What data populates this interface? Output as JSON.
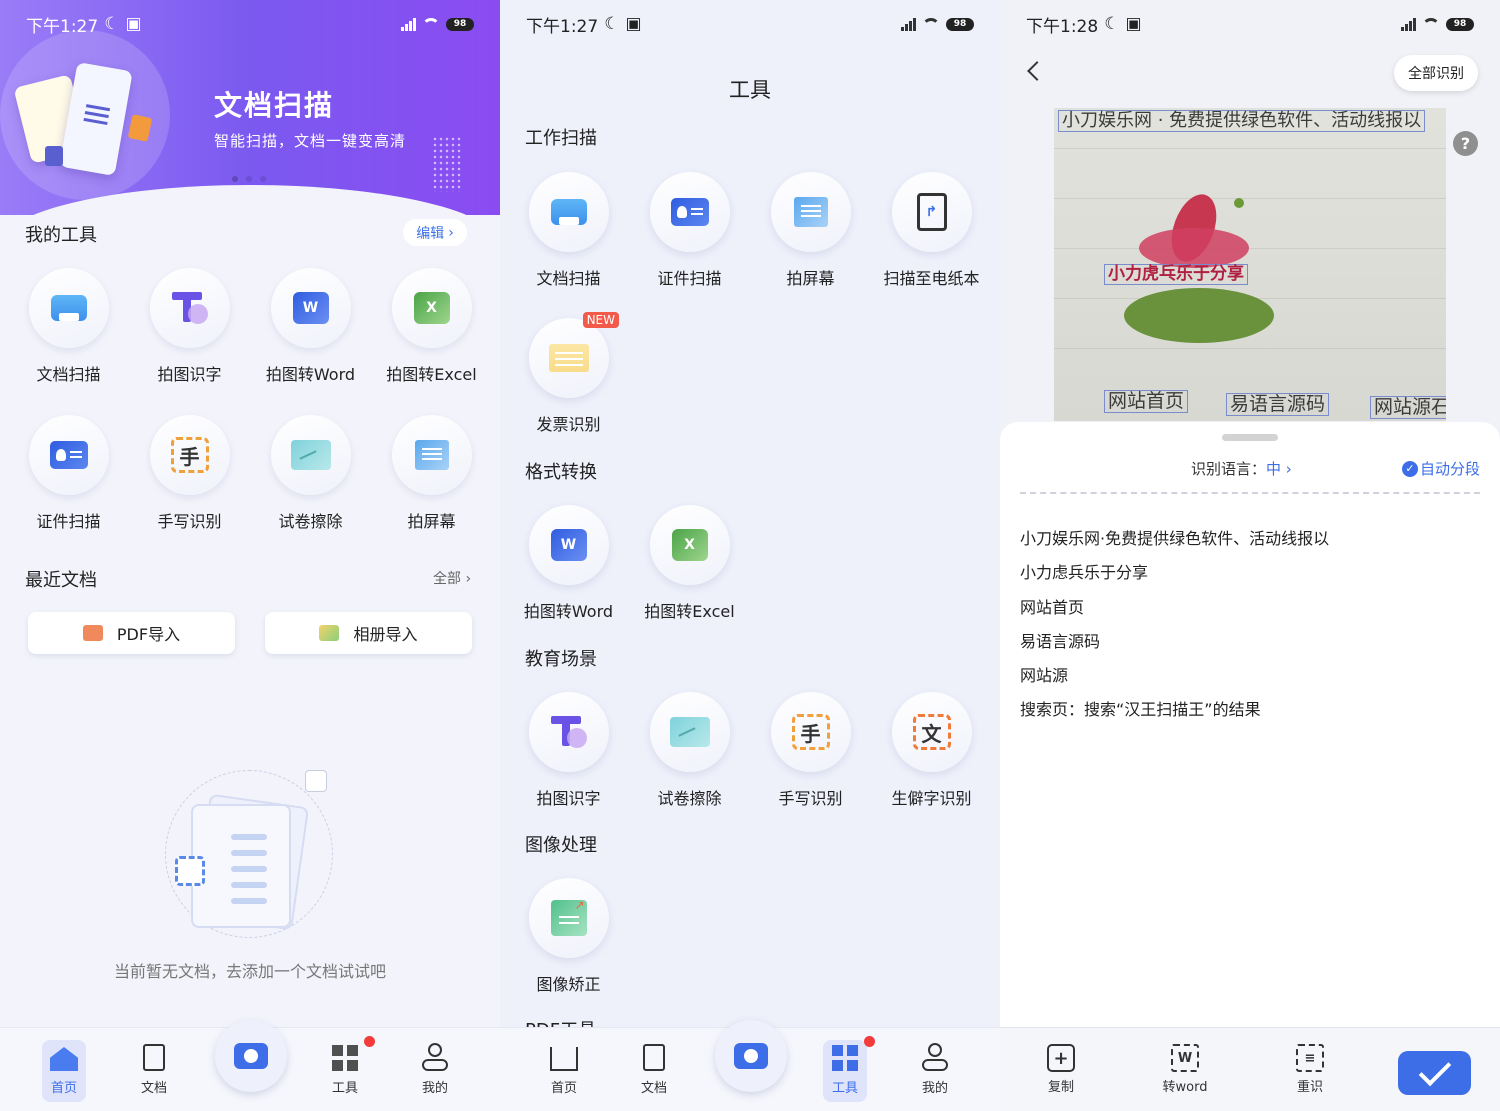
{
  "status": [
    {
      "time": "下午1:27",
      "battery": "98"
    },
    {
      "time": "下午1:27",
      "battery": "98"
    },
    {
      "time": "下午1:28",
      "battery": "98"
    }
  ],
  "home": {
    "banner": {
      "title": "文档扫描",
      "subtitle": "智能扫描，文档一键变高清"
    },
    "my_tools_title": "我的工具",
    "edit_label": "编辑",
    "tools": [
      {
        "label": "文档扫描",
        "icon": "printer-icon"
      },
      {
        "label": "拍图识字",
        "icon": "text-recognition-icon"
      },
      {
        "label": "拍图转Word",
        "icon": "word-icon"
      },
      {
        "label": "拍图转Excel",
        "icon": "excel-icon"
      },
      {
        "label": "证件扫描",
        "icon": "id-card-icon"
      },
      {
        "label": "手写识别",
        "icon": "handwriting-icon"
      },
      {
        "label": "试卷擦除",
        "icon": "exam-erase-icon"
      },
      {
        "label": "拍屏幕",
        "icon": "screen-icon"
      }
    ],
    "recent_title": "最近文档",
    "all_label": "全部",
    "pdf_import": "PDF导入",
    "album_import": "相册导入",
    "empty_text": "当前暂无文档，去添加一个文档试试吧"
  },
  "tabs": {
    "home": "首页",
    "docs": "文档",
    "tools": "工具",
    "mine": "我的"
  },
  "tools_page": {
    "title": "工具",
    "sections": [
      {
        "title": "工作扫描",
        "items": [
          {
            "label": "文档扫描",
            "icon": "printer-icon"
          },
          {
            "label": "证件扫描",
            "icon": "id-card-icon"
          },
          {
            "label": "拍屏幕",
            "icon": "screen-icon"
          },
          {
            "label": "扫描至电纸本",
            "icon": "e-paper-icon"
          },
          {
            "label": "发票识别",
            "icon": "invoice-icon",
            "badge": "NEW"
          }
        ]
      },
      {
        "title": "格式转换",
        "items": [
          {
            "label": "拍图转Word",
            "icon": "word-icon"
          },
          {
            "label": "拍图转Excel",
            "icon": "excel-icon"
          }
        ]
      },
      {
        "title": "教育场景",
        "items": [
          {
            "label": "拍图识字",
            "icon": "text-recognition-icon"
          },
          {
            "label": "试卷擦除",
            "icon": "exam-erase-icon"
          },
          {
            "label": "手写识别",
            "icon": "handwriting-icon"
          },
          {
            "label": "生僻字识别",
            "icon": "rare-char-icon"
          }
        ]
      },
      {
        "title": "图像处理",
        "items": [
          {
            "label": "图像矫正",
            "icon": "image-correct-icon"
          }
        ]
      },
      {
        "title": "PDF工具",
        "items": []
      }
    ]
  },
  "ocr_page": {
    "recognize_all": "全部识别",
    "photo_boxes": [
      "小刀娱乐网 · 免费提供绿色软件、活动线报以",
      "小力虎乓乐于分享",
      "网站首页",
      "易语言源码",
      "网站源石"
    ],
    "lang_label": "识别语言：",
    "lang_value": "中",
    "auto_segment": "自动分段",
    "results": [
      "小刀娱乐网·免费提供绿色软件、活动线报以",
      "小力虑兵乐于分享",
      "网站首页",
      "易语言源码",
      "网站源",
      "搜索页：搜索“汉王扫描王”的结果"
    ],
    "bottom": {
      "copy": "复制",
      "to_word": "转word",
      "reread": "重识"
    }
  },
  "colors": {
    "accent": "#3d6ee8",
    "banner": "#7b59f0",
    "badge": "#f25a4a"
  }
}
